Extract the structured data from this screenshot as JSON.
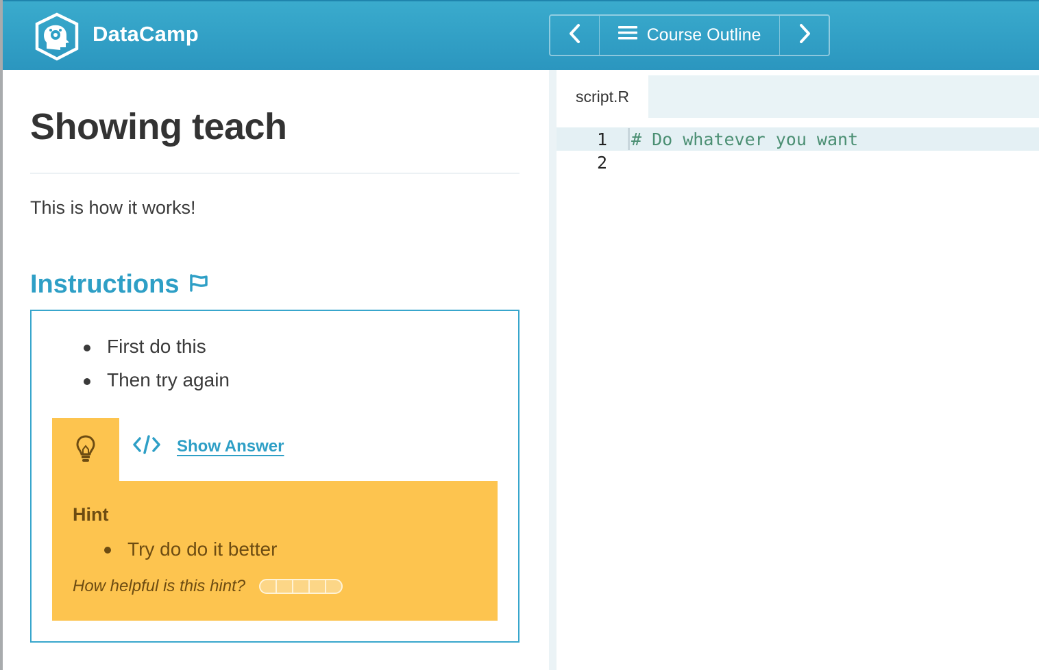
{
  "app": {
    "brand": "DataCamp"
  },
  "nav": {
    "outline_label": "Course Outline"
  },
  "exercise": {
    "title": "Showing teach",
    "description": "This is how it works!",
    "instructions_heading": "Instructions",
    "instructions": [
      "First do this",
      "Then try again"
    ],
    "show_answer_label": "Show Answer",
    "hint": {
      "title": "Hint",
      "items": [
        "Try do do it better"
      ],
      "helpful_question": "How helpful is this hint?",
      "rating_segments": 5
    }
  },
  "editor": {
    "tab_label": "script.R",
    "lines": [
      {
        "number": "1",
        "text": "# Do whatever you want"
      },
      {
        "number": "2",
        "text": ""
      }
    ]
  },
  "colors": {
    "header": "#2b96bf",
    "accent": "#2e9fc6",
    "hint_bg": "#fdc44f",
    "hint_text": "#6d4c12",
    "comment": "#4b8f73"
  },
  "icons": {
    "logo": "datacamp-logo-icon",
    "prev": "chevron-left-icon",
    "outline": "hamburger-menu-icon",
    "next": "chevron-right-icon",
    "instructions": "flag-icon",
    "hint": "lightbulb-icon",
    "answer": "code-icon"
  }
}
